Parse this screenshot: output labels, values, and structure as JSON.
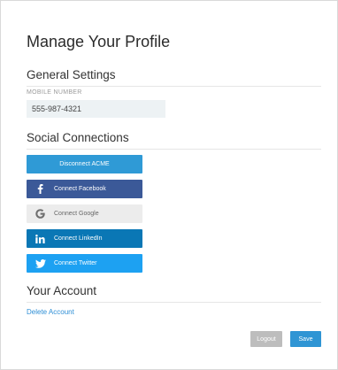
{
  "page": {
    "title": "Manage Your Profile"
  },
  "general": {
    "heading": "General Settings",
    "mobile_label": "MOBILE NUMBER",
    "mobile_value": "555-987-4321"
  },
  "social": {
    "heading": "Social Connections",
    "buttons": [
      {
        "label": "Disconnect ACME",
        "color": "#2f9ad6"
      },
      {
        "label": "Connect Facebook",
        "icon": "facebook-icon",
        "color": "#3b5998"
      },
      {
        "label": "Connect Google",
        "icon": "google-icon",
        "color": "#ececec"
      },
      {
        "label": "Connect LinkedIn",
        "icon": "linkedin-icon",
        "color": "#0a77b5"
      },
      {
        "label": "Connect Twitter",
        "icon": "twitter-icon",
        "color": "#1da1f2"
      }
    ]
  },
  "account": {
    "heading": "Your Account",
    "delete_label": "Delete Account"
  },
  "actions": {
    "logout_label": "Logout",
    "save_label": "Save"
  }
}
